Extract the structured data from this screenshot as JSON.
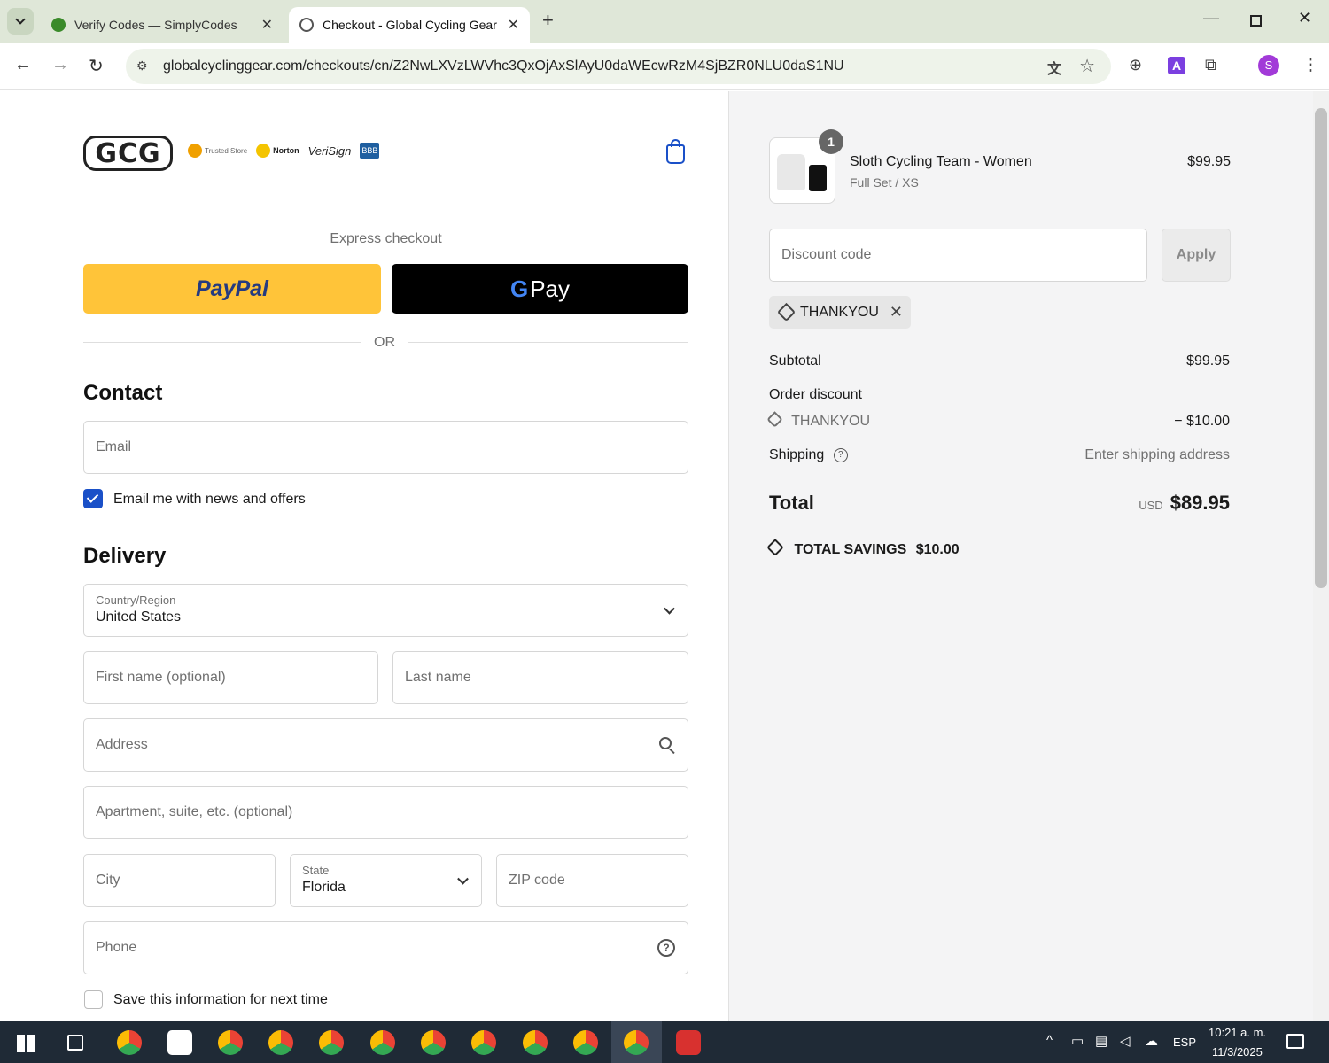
{
  "browser": {
    "tabs": [
      {
        "title": "Verify Codes — SimplyCodes"
      },
      {
        "title": "Checkout - Global Cycling Gear"
      }
    ],
    "url": "globalcyclinggear.com/checkouts/cn/Z2NwLXVzLWVhc3QxOjAxSlAyU0daWEcwRzM4SjBZR0NLU0daS1NU",
    "profile_initial": "S"
  },
  "store": {
    "logo_text": "GCG",
    "badges": [
      "Trusted Store",
      "Norton",
      "VeriSign",
      "BBB"
    ]
  },
  "express": {
    "label": "Express checkout",
    "paypal_label": "PayPal",
    "gpay_label": "Pay",
    "or_label": "OR"
  },
  "contact": {
    "heading": "Contact",
    "email_placeholder": "Email",
    "newsletter_label": "Email me with news and offers"
  },
  "delivery": {
    "heading": "Delivery",
    "country_label": "Country/Region",
    "country_value": "United States",
    "first_name_placeholder": "First name (optional)",
    "last_name_placeholder": "Last name",
    "address_placeholder": "Address",
    "apartment_placeholder": "Apartment, suite, etc. (optional)",
    "city_placeholder": "City",
    "state_label": "State",
    "state_value": "Florida",
    "zip_placeholder": "ZIP code",
    "phone_placeholder": "Phone",
    "save_info_label": "Save this information for next time"
  },
  "summary": {
    "item": {
      "quantity": "1",
      "name": "Sloth Cycling Team - Women",
      "variant": "Full Set / XS",
      "price": "$99.95"
    },
    "discount_placeholder": "Discount code",
    "apply_label": "Apply",
    "applied_code": "THANKYOU",
    "subtotal_label": "Subtotal",
    "subtotal_value": "$99.95",
    "order_discount_label": "Order discount",
    "order_discount_code": "THANKYOU",
    "order_discount_value": "− $10.00",
    "shipping_label": "Shipping",
    "shipping_value": "Enter shipping address",
    "total_label": "Total",
    "currency": "USD",
    "total_value": "$89.95",
    "savings_label": "TOTAL SAVINGS",
    "savings_value": "$10.00"
  },
  "taskbar": {
    "language": "ESP",
    "time": "10:21 a. m.",
    "date": "11/3/2025"
  },
  "colors": {
    "paypal": "#ffc439",
    "gpay": "#000000",
    "accent": "#1a50c8"
  }
}
